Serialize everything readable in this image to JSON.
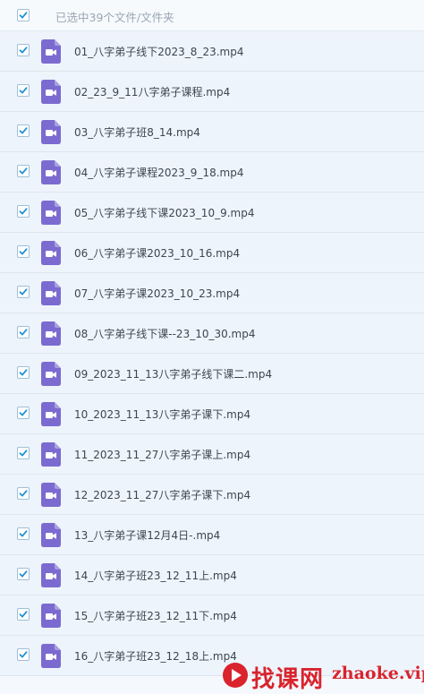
{
  "header": {
    "selection_text": "已选中39个文件/文件夹"
  },
  "files": [
    {
      "name": "01_八字弟子线下2023_8_23.mp4"
    },
    {
      "name": "02_23_9_11八字弟子课程.mp4"
    },
    {
      "name": "03_八字弟子班8_14.mp4"
    },
    {
      "name": "04_八字弟子课程2023_9_18.mp4"
    },
    {
      "name": "05_八字弟子线下课2023_10_9.mp4"
    },
    {
      "name": "06_八字弟子课2023_10_16.mp4"
    },
    {
      "name": "07_八字弟子课2023_10_23.mp4"
    },
    {
      "name": "08_八字弟子线下课--23_10_30.mp4"
    },
    {
      "name": "09_2023_11_13八字弟子线下课二.mp4"
    },
    {
      "name": "10_2023_11_13八字弟子课下.mp4"
    },
    {
      "name": "11_2023_11_27八字弟子课上.mp4"
    },
    {
      "name": "12_2023_11_27八字弟子课下.mp4"
    },
    {
      "name": "13_八字弟子课12月4日-.mp4"
    },
    {
      "name": "14_八字弟子班23_12_11上.mp4"
    },
    {
      "name": "15_八字弟子班23_12_11下.mp4"
    },
    {
      "name": "16_八字弟子班23_12_18上.mp4"
    }
  ],
  "watermark": {
    "cn_text": "找课网",
    "url_text": "zhaoke.vip"
  },
  "colors": {
    "checkbox_check": "#1e90d6",
    "video_icon": "#7b6bd0",
    "watermark": "#d9232d"
  },
  "icons": {
    "file_icon": "video-file-icon",
    "checkbox": "checkmark-icon"
  }
}
